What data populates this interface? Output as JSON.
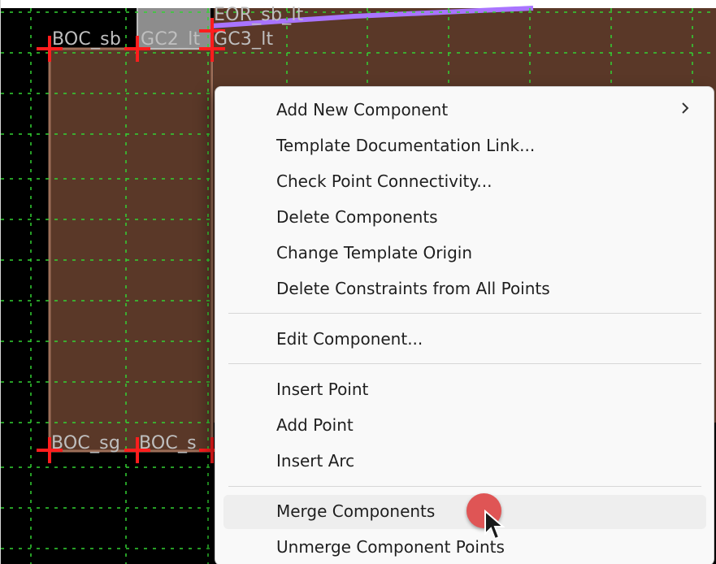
{
  "canvas": {
    "labels": {
      "eor": "EOR_sb_lt",
      "boc_top": "BOC_sb",
      "gc2": "GC2_lt",
      "gc3": "GC3_lt",
      "boc_bottom": "BOC_sg",
      "bottom_overlap": "BOC_s"
    },
    "colors": {
      "background": "#000000",
      "component_fill": "#5a3828",
      "outline": "#9c6e58",
      "grid": "#32d332",
      "point_marker": "#ff1d1d",
      "connector": "#a974ff"
    }
  },
  "context_menu": {
    "items": {
      "add_new_component": "Add New Component",
      "template_documentation_link": "Template Documentation Link...",
      "check_point_connectivity": "Check Point Connectivity...",
      "delete_components": "Delete Components",
      "change_template_origin": "Change Template Origin",
      "delete_constraints_all_points": "Delete Constraints from All Points",
      "edit_component": "Edit Component...",
      "insert_point": "Insert Point",
      "add_point": "Add Point",
      "insert_arc": "Insert Arc",
      "merge_components": "Merge Components",
      "unmerge_component_points": "Unmerge Component Points"
    },
    "submenu_icon": "chevron-right-icon",
    "hovered_item": "Merge Components"
  },
  "pointer": {
    "click_indicator_icon": "click-indicator-icon",
    "cursor_icon": "mouse-pointer-icon",
    "indicator_color": "#df5555"
  }
}
